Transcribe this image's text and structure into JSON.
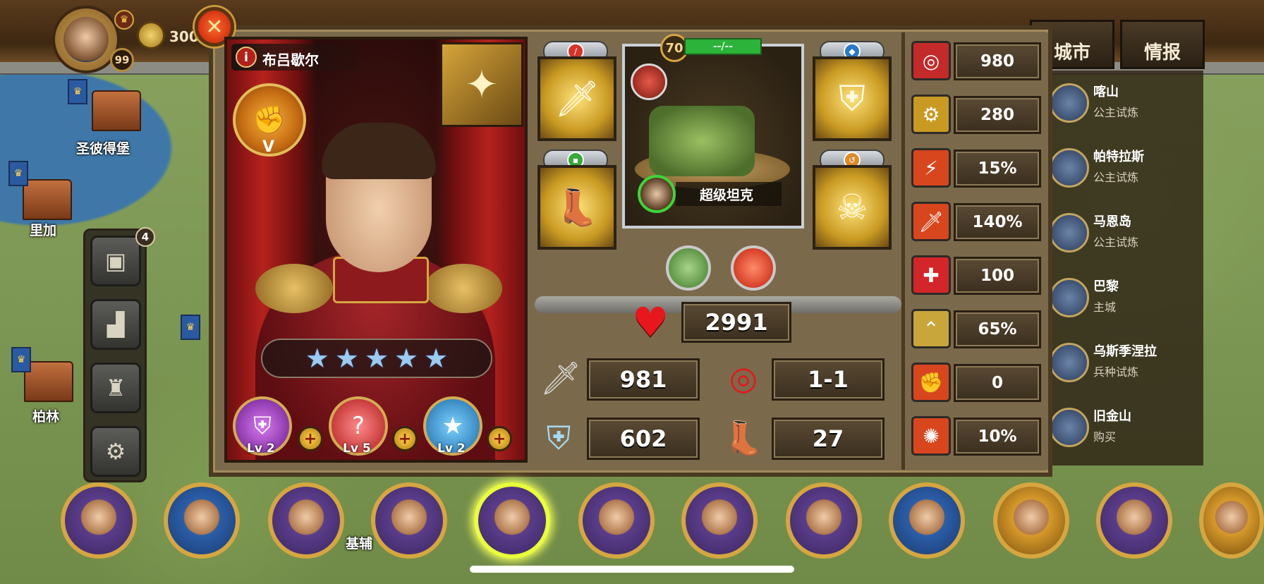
{
  "player": {
    "level": "99",
    "gold": "300"
  },
  "hero": {
    "name": "布吕歇尔",
    "rank": "V",
    "stars": 5,
    "skills": [
      {
        "level": "Lv 2",
        "icon": "armor-icon",
        "color": "#a64ac9"
      },
      {
        "level": "Lv 5",
        "icon": "lips-icon",
        "color": "#d23a3a"
      },
      {
        "level": "Lv 2",
        "icon": "star-medal-icon",
        "color": "#2a8ad0"
      }
    ]
  },
  "unit": {
    "level": "70",
    "xp_text": "--/--",
    "name": "超级坦克"
  },
  "stats": {
    "hp": "2991",
    "attack": "981",
    "range": "1-1",
    "defense": "602",
    "speed": "27"
  },
  "right_stats": [
    {
      "icon": "target-icon",
      "value": "980",
      "color": "#c42a2a"
    },
    {
      "icon": "gear-arm-icon",
      "value": "280",
      "color": "#c99a22"
    },
    {
      "icon": "lightning-icon",
      "value": "15%",
      "color": "#d8461e"
    },
    {
      "icon": "sword-fire-icon",
      "value": "140%",
      "color": "#d8461e"
    },
    {
      "icon": "medical-cross-icon",
      "value": "100",
      "color": "#d4262a"
    },
    {
      "icon": "rank-chevron-icon",
      "value": "65%",
      "color": "#c9a63a"
    },
    {
      "icon": "fist-icon",
      "value": "0",
      "color": "#d8461e"
    },
    {
      "icon": "figure-burst-icon",
      "value": "10%",
      "color": "#d8461e"
    }
  ],
  "tabs": {
    "city": "城市",
    "intel": "情报"
  },
  "cities": [
    {
      "name": "喀山",
      "sub": "公主试炼"
    },
    {
      "name": "帕特拉斯",
      "sub": "公主试炼"
    },
    {
      "name": "马恩岛",
      "sub": "公主试炼"
    },
    {
      "name": "巴黎",
      "sub": "主城"
    },
    {
      "name": "乌斯季涅拉",
      "sub": "兵种试炼"
    },
    {
      "name": "旧金山",
      "sub": "购买"
    }
  ],
  "map_labels": {
    "st_petersburg": "圣彼得堡",
    "riga": "里加",
    "berlin": "柏林",
    "kiev": "基辅"
  },
  "menu": {
    "notification_count": "4"
  },
  "roster_count": 12
}
